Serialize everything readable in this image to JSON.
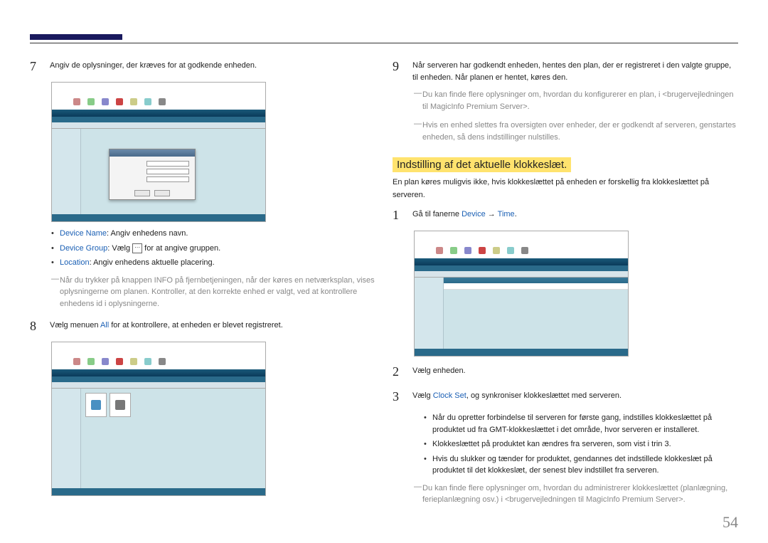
{
  "page_number": "54",
  "left": {
    "step7": {
      "text": "Angiv de oplysninger, der kræves for at godkende enheden."
    },
    "bullets7": {
      "b1_kw": "Device Name",
      "b1_rest": ": Angiv enhedens navn.",
      "b2_kw": "Device Group",
      "b2_rest_a": ": Vælg ",
      "b2_rest_b": " for at angive gruppen.",
      "b3_kw": "Location",
      "b3_rest": ": Angiv enhedens aktuelle placering."
    },
    "note7": "Når du trykker på knappen INFO på fjernbetjeningen, når der køres en netværksplan, vises oplysningerne om planen. Kontroller, at den korrekte enhed er valgt, ved at kontrollere enhedens id i oplysningerne.",
    "step8_a": "Vælg menuen ",
    "step8_kw": "All",
    "step8_b": " for at kontrollere, at enheden er blevet registreret."
  },
  "right": {
    "step9": "Når serveren har godkendt enheden, hentes den plan, der er registreret i den valgte gruppe, til enheden. Når planen er hentet, køres den.",
    "note9a": "Du kan finde flere oplysninger om, hvordan du konfigurerer en plan, i <brugervejledningen til MagicInfo Premium Server>.",
    "note9b": "Hvis en enhed slettes fra oversigten over enheder, der er godkendt af serveren, genstartes enheden, så dens indstillinger nulstilles.",
    "heading": "Indstilling af det aktuelle klokkeslæt.",
    "intro": "En plan køres muligvis ikke, hvis klokkeslættet på enheden er forskellig fra klokkeslættet på serveren.",
    "step1_a": "Gå til fanerne ",
    "step1_kw1": "Device",
    "step1_arrow": " → ",
    "step1_kw2": "Time",
    "step1_c": ".",
    "step2": "Vælg enheden.",
    "step3_a": "Vælg ",
    "step3_kw": "Clock Set",
    "step3_b": ", og synkroniser klokkeslættet med serveren.",
    "bullets3": {
      "b1": "Når du opretter forbindelse til serveren for første gang, indstilles klokkeslættet på produktet ud fra GMT-klokkeslættet i det område, hvor serveren er installeret.",
      "b2": "Klokkeslættet på produktet kan ændres fra serveren, som vist i trin 3.",
      "b3": "Hvis du slukker og tænder for produktet, gendannes det indstillede klokkeslæt på produktet til det klokkeslæt, der senest blev indstillet fra serveren."
    },
    "note_end": "Du kan finde flere oplysninger om, hvordan du administrerer klokkeslættet (planlægning, ferieplanlægning osv.) i <brugervejledningen til MagicInfo Premium Server>."
  }
}
